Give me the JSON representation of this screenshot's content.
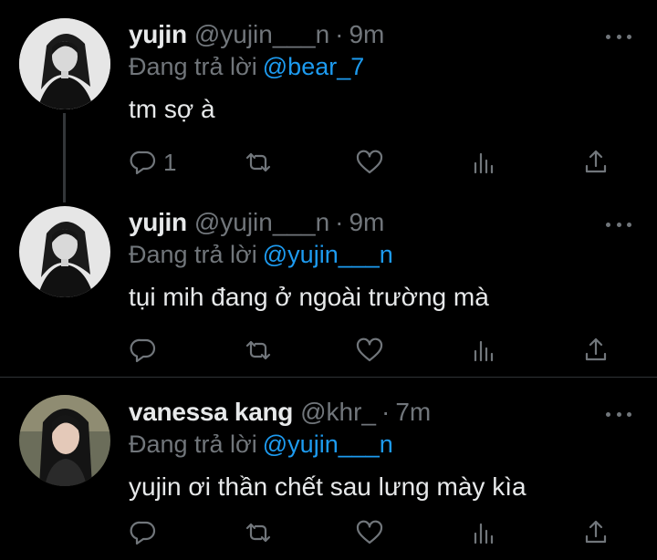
{
  "tweets": [
    {
      "name": "yujin",
      "handle": "@yujin___n",
      "dot": "·",
      "time": "9m",
      "reply_prefix": "Đang trả lời",
      "reply_to": "@bear_7",
      "text": "tm sợ à",
      "reply_count": "1",
      "avatar": "grayscale-portrait"
    },
    {
      "name": "yujin",
      "handle": "@yujin___n",
      "dot": "·",
      "time": "9m",
      "reply_prefix": "Đang trả lời",
      "reply_to": "@yujin___n",
      "text": "tụi mih đang ở ngoài trường mà",
      "reply_count": "",
      "avatar": "grayscale-portrait"
    },
    {
      "name": "vanessa kang",
      "handle": "@khr_",
      "dot": "·",
      "time": "7m",
      "reply_prefix": "Đang trả lời",
      "reply_to": "@yujin___n",
      "text": "yujin ơi thần chết sau lưng mày kìa",
      "reply_count": "",
      "avatar": "color-portrait"
    }
  ],
  "icons": {
    "reply": "reply-icon",
    "retweet": "retweet-icon",
    "like": "heart-icon",
    "views": "views-icon",
    "share": "share-icon",
    "more": "more-options-icon"
  },
  "colors": {
    "background": "#000000",
    "text": "#e7e9ea",
    "secondary": "#71767b",
    "accent": "#1d9bf0",
    "divider": "#2f3336"
  }
}
